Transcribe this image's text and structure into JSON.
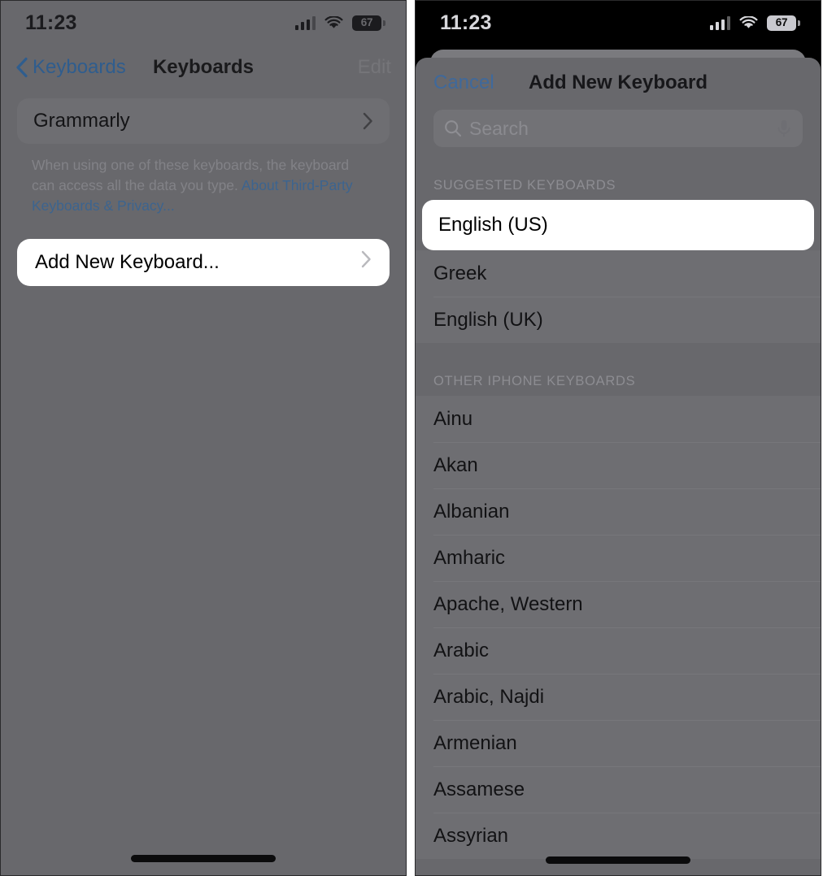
{
  "left_panel": {
    "status_bar": {
      "time": "11:23",
      "battery_percent": "67",
      "icons": [
        "cellular-signal-icon",
        "wifi-icon",
        "battery-icon"
      ]
    },
    "nav": {
      "back_label": "Keyboards",
      "title": "Keyboards",
      "edit_label": "Edit"
    },
    "keyboard_group": [
      {
        "label": "Grammarly",
        "accessory": "chevron-right-icon"
      }
    ],
    "footnote": {
      "text": "When using one of these keyboards, the keyboard can access all the data you type. ",
      "link": "About Third-Party Keyboards & Privacy..."
    },
    "add_keyboard_row": {
      "label": "Add New Keyboard...",
      "accessory": "chevron-right-icon",
      "highlighted": true
    }
  },
  "right_panel": {
    "status_bar": {
      "time": "11:23",
      "battery_percent": "67",
      "icons": [
        "cellular-signal-icon",
        "wifi-icon",
        "battery-icon"
      ]
    },
    "sheet_nav": {
      "cancel_label": "Cancel",
      "title": "Add New Keyboard"
    },
    "search": {
      "placeholder": "Search",
      "value": "",
      "leading_icon": "search-icon",
      "trailing_icon": "microphone-icon"
    },
    "suggested": {
      "header": "SUGGESTED KEYBOARDS",
      "items": [
        {
          "label": "English (US)",
          "highlighted": true
        },
        {
          "label": "Greek",
          "highlighted": false
        },
        {
          "label": "English (UK)",
          "highlighted": false
        }
      ]
    },
    "other": {
      "header": "OTHER IPHONE KEYBOARDS",
      "items": [
        {
          "label": "Ainu"
        },
        {
          "label": "Akan"
        },
        {
          "label": "Albanian"
        },
        {
          "label": "Amharic"
        },
        {
          "label": "Apache, Western"
        },
        {
          "label": "Arabic"
        },
        {
          "label": "Arabic, Najdi"
        },
        {
          "label": "Armenian"
        },
        {
          "label": "Assamese"
        },
        {
          "label": "Assyrian"
        }
      ]
    }
  },
  "colors": {
    "dim_scrim": "#68686c",
    "highlight_white": "#ffffff",
    "link_blue": "#3c648f",
    "tint_blue": "#2f5d8e",
    "status_black": "#000000"
  }
}
